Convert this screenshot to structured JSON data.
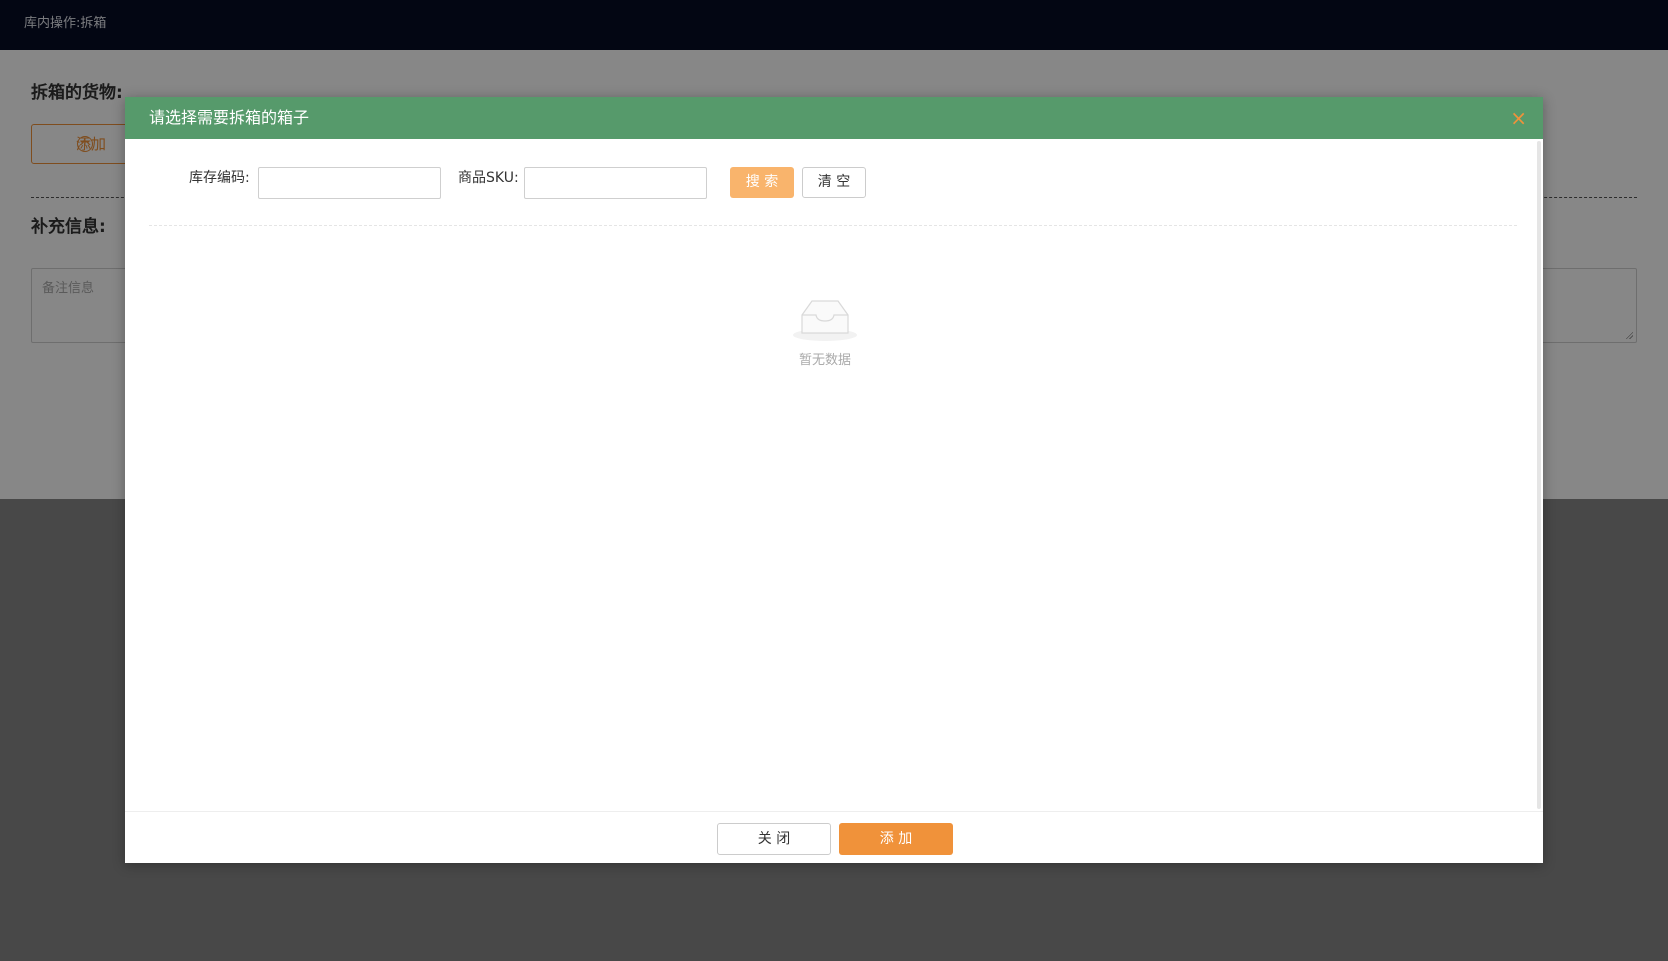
{
  "page": {
    "header_title": "库内操作:拆箱",
    "section_goods_title": "拆箱的货物:",
    "add_button_label": "添加",
    "section_extra_title": "补充信息:",
    "remarks_placeholder": "备注信息"
  },
  "modal": {
    "title": "请选择需要拆箱的箱子",
    "close_icon": "×",
    "fields": {
      "stock_code_label": "库存编码:",
      "stock_code_value": "",
      "sku_label": "商品SKU:",
      "sku_value": ""
    },
    "search_button": "搜 索",
    "clear_button": "清 空",
    "empty_text": "暂无数据",
    "footer": {
      "close_button": "关 闭",
      "add_button": "添 加"
    }
  },
  "colors": {
    "header_bg": "#070c25",
    "modal_header_bg": "#569a6b",
    "accent_orange": "#f0923a",
    "search_button_bg": "#f9b46c"
  },
  "icons": {
    "close": "close-icon",
    "empty": "empty-inbox-icon",
    "add": "plus-circle-icon"
  }
}
